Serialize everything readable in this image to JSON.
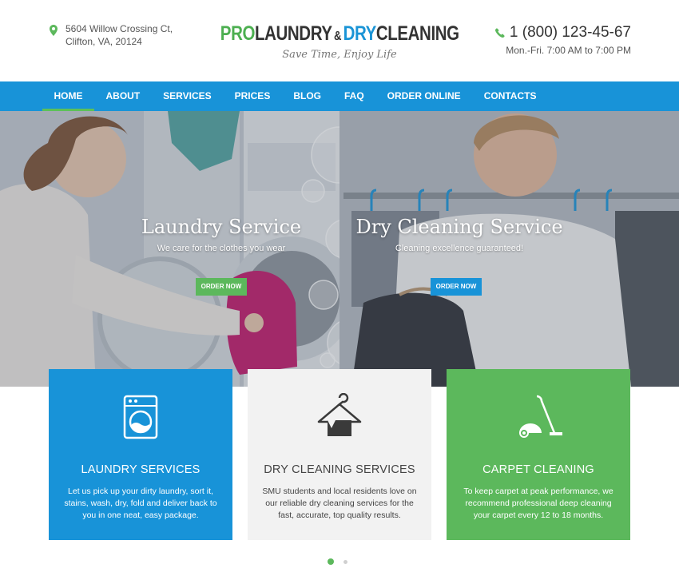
{
  "header": {
    "address_line1": "5604 Willow Crossing Ct,",
    "address_line2": "Clifton, VA, 20124",
    "logo": {
      "pro": "PRO",
      "laundry": "LAUNDRY",
      "amp": "&",
      "dry": "DRY",
      "cleaning": "CLEANING",
      "tagline": "Save Time, Enjoy Life"
    },
    "phone": "1 (800) 123-45-67",
    "hours": "Mon.-Fri. 7:00 AM to 7:00 PM"
  },
  "nav": {
    "items": [
      {
        "label": "HOME",
        "active": true
      },
      {
        "label": "ABOUT"
      },
      {
        "label": "SERVICES"
      },
      {
        "label": "PRICES"
      },
      {
        "label": "BLOG"
      },
      {
        "label": "FAQ"
      },
      {
        "label": "ORDER ONLINE"
      },
      {
        "label": "CONTACTS"
      }
    ]
  },
  "hero": {
    "left": {
      "title": "Laundry Service",
      "subtitle": "We care for the clothes you wear",
      "button": "ORDER NOW"
    },
    "right": {
      "title": "Dry Cleaning Service",
      "subtitle": "Cleaning excellence guaranteed!",
      "button": "ORDER NOW"
    }
  },
  "cards": [
    {
      "icon": "washing-machine-icon",
      "title": "LAUNDRY SERVICES",
      "text": "Let us pick up your dirty laundry, sort it, stains, wash, dry, fold and deliver back to you in one neat, easy package."
    },
    {
      "icon": "hanger-icon",
      "title": "DRY CLEANING SERVICES",
      "text": "SMU students and local residents love on our reliable dry cleaning services for the fast, accurate, top quality results."
    },
    {
      "icon": "vacuum-cleaner-icon",
      "title": "CARPET CLEANING",
      "text": "To keep carpet at peak performance, we recommend professional deep cleaning your carpet every 12 to 18 months."
    }
  ],
  "colors": {
    "brand_blue": "#1893d8",
    "brand_green": "#5cb85c",
    "card_gray": "#f2f2f2"
  }
}
